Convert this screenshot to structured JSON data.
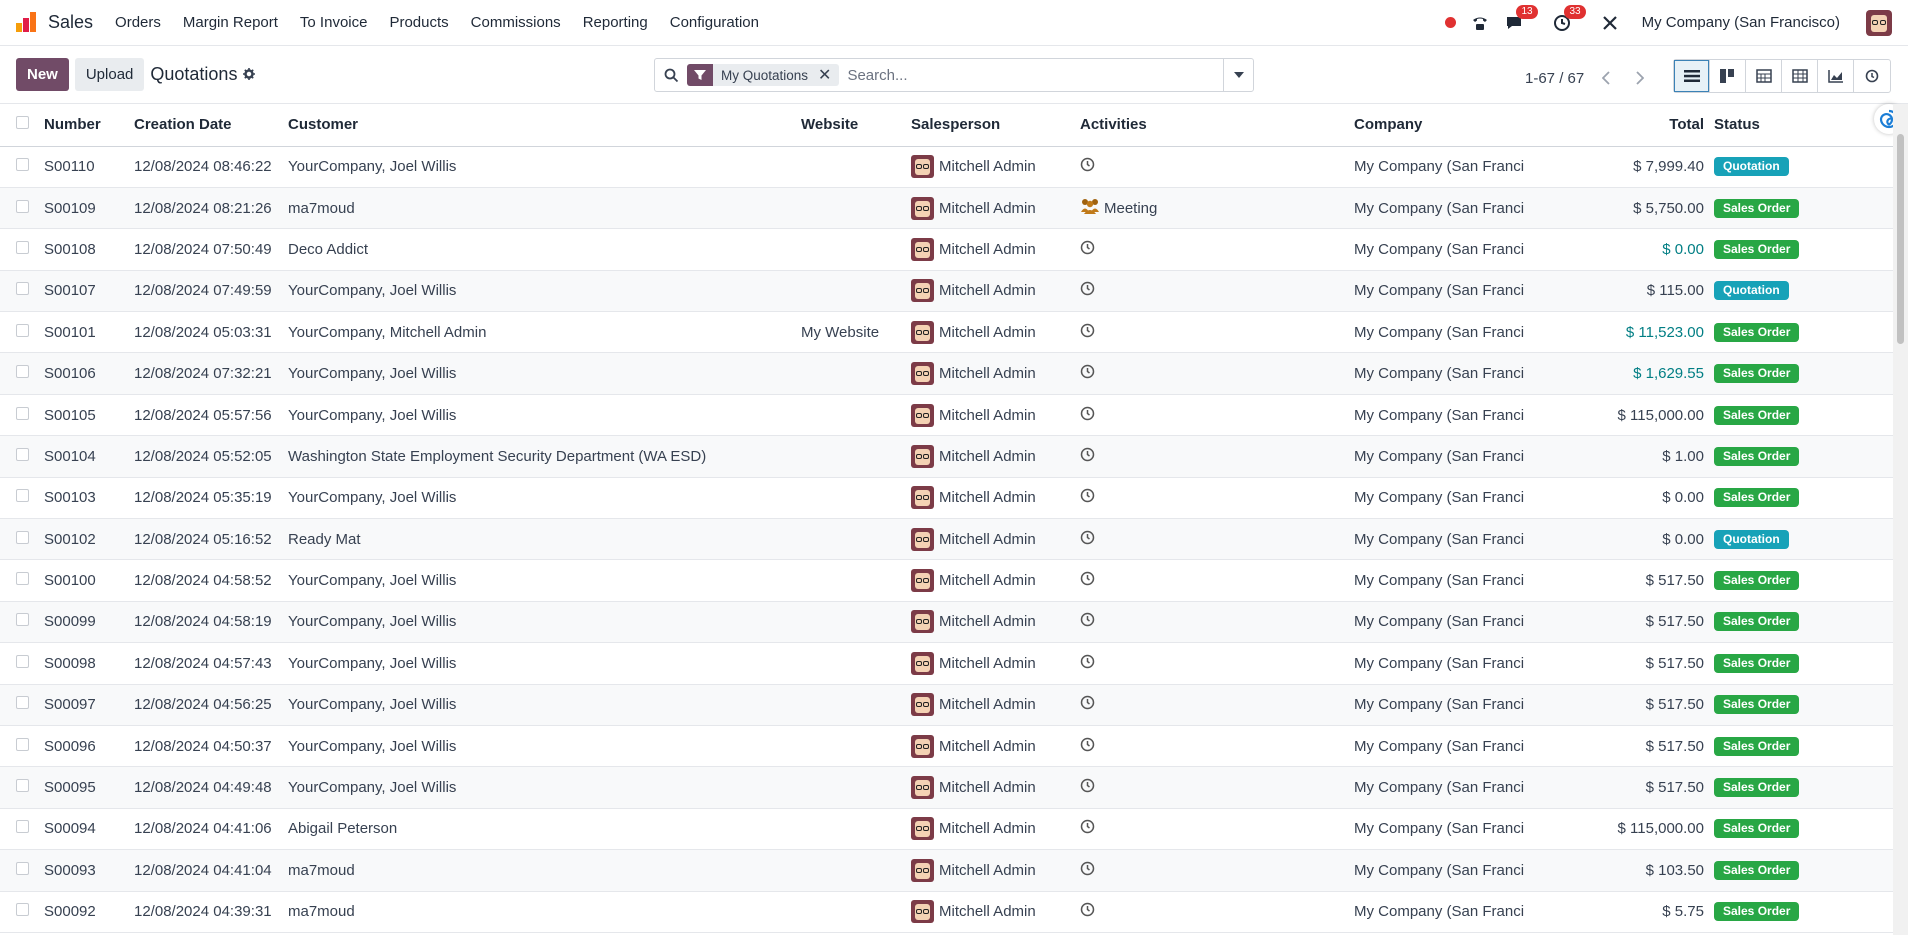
{
  "navbar": {
    "app_name": "Sales",
    "menu": [
      "Orders",
      "Margin Report",
      "To Invoice",
      "Products",
      "Commissions",
      "Reporting",
      "Configuration"
    ],
    "messages_count": "13",
    "activities_count": "33",
    "company": "My Company (San Francisco)"
  },
  "control": {
    "new_label": "New",
    "upload_label": "Upload",
    "breadcrumb": "Quotations",
    "facet_label": "My Quotations",
    "search_placeholder": "Search...",
    "pager": "1-67 / 67"
  },
  "table": {
    "headers": {
      "number": "Number",
      "creation_date": "Creation Date",
      "customer": "Customer",
      "website": "Website",
      "salesperson": "Salesperson",
      "activities": "Activities",
      "company": "Company",
      "total": "Total",
      "status": "Status"
    },
    "rows": [
      {
        "number": "S00110",
        "date": "12/08/2024 08:46:22",
        "customer": "YourCompany, Joel Willis",
        "website": "",
        "salesperson": "Mitchell Admin",
        "activity": "",
        "company": "My Company (San Francisco)",
        "total": "$ 7,999.40",
        "total_highlight": false,
        "status": "Quotation"
      },
      {
        "number": "S00109",
        "date": "12/08/2024 08:21:26",
        "customer": "ma7moud",
        "website": "",
        "salesperson": "Mitchell Admin",
        "activity": "Meeting",
        "company": "My Company (San Francisco)",
        "total": "$ 5,750.00",
        "total_highlight": false,
        "status": "Sales Order"
      },
      {
        "number": "S00108",
        "date": "12/08/2024 07:50:49",
        "customer": "Deco Addict",
        "website": "",
        "salesperson": "Mitchell Admin",
        "activity": "",
        "company": "My Company (San Francisco)",
        "total": "$ 0.00",
        "total_highlight": true,
        "status": "Sales Order"
      },
      {
        "number": "S00107",
        "date": "12/08/2024 07:49:59",
        "customer": "YourCompany, Joel Willis",
        "website": "",
        "salesperson": "Mitchell Admin",
        "activity": "",
        "company": "My Company (San Francisco)",
        "total": "$ 115.00",
        "total_highlight": false,
        "status": "Quotation"
      },
      {
        "number": "S00101",
        "date": "12/08/2024 05:03:31",
        "customer": "YourCompany, Mitchell Admin",
        "website": "My Website",
        "salesperson": "Mitchell Admin",
        "activity": "",
        "company": "My Company (San Francisco)",
        "total": "$ 11,523.00",
        "total_highlight": true,
        "status": "Sales Order"
      },
      {
        "number": "S00106",
        "date": "12/08/2024 07:32:21",
        "customer": "YourCompany, Joel Willis",
        "website": "",
        "salesperson": "Mitchell Admin",
        "activity": "",
        "company": "My Company (San Francisco)",
        "total": "$ 1,629.55",
        "total_highlight": true,
        "status": "Sales Order"
      },
      {
        "number": "S00105",
        "date": "12/08/2024 05:57:56",
        "customer": "YourCompany, Joel Willis",
        "website": "",
        "salesperson": "Mitchell Admin",
        "activity": "",
        "company": "My Company (San Francisco)",
        "total": "$ 115,000.00",
        "total_highlight": false,
        "status": "Sales Order"
      },
      {
        "number": "S00104",
        "date": "12/08/2024 05:52:05",
        "customer": "Washington State Employment Security Department (WA ESD)",
        "website": "",
        "salesperson": "Mitchell Admin",
        "activity": "",
        "company": "My Company (San Francisco)",
        "total": "$ 1.00",
        "total_highlight": false,
        "status": "Sales Order"
      },
      {
        "number": "S00103",
        "date": "12/08/2024 05:35:19",
        "customer": "YourCompany, Joel Willis",
        "website": "",
        "salesperson": "Mitchell Admin",
        "activity": "",
        "company": "My Company (San Francisco)",
        "total": "$ 0.00",
        "total_highlight": false,
        "status": "Sales Order"
      },
      {
        "number": "S00102",
        "date": "12/08/2024 05:16:52",
        "customer": "Ready Mat",
        "website": "",
        "salesperson": "Mitchell Admin",
        "activity": "",
        "company": "My Company (San Francisco)",
        "total": "$ 0.00",
        "total_highlight": false,
        "status": "Quotation"
      },
      {
        "number": "S00100",
        "date": "12/08/2024 04:58:52",
        "customer": "YourCompany, Joel Willis",
        "website": "",
        "salesperson": "Mitchell Admin",
        "activity": "",
        "company": "My Company (San Francisco)",
        "total": "$ 517.50",
        "total_highlight": false,
        "status": "Sales Order"
      },
      {
        "number": "S00099",
        "date": "12/08/2024 04:58:19",
        "customer": "YourCompany, Joel Willis",
        "website": "",
        "salesperson": "Mitchell Admin",
        "activity": "",
        "company": "My Company (San Francisco)",
        "total": "$ 517.50",
        "total_highlight": false,
        "status": "Sales Order"
      },
      {
        "number": "S00098",
        "date": "12/08/2024 04:57:43",
        "customer": "YourCompany, Joel Willis",
        "website": "",
        "salesperson": "Mitchell Admin",
        "activity": "",
        "company": "My Company (San Francisco)",
        "total": "$ 517.50",
        "total_highlight": false,
        "status": "Sales Order"
      },
      {
        "number": "S00097",
        "date": "12/08/2024 04:56:25",
        "customer": "YourCompany, Joel Willis",
        "website": "",
        "salesperson": "Mitchell Admin",
        "activity": "",
        "company": "My Company (San Francisco)",
        "total": "$ 517.50",
        "total_highlight": false,
        "status": "Sales Order"
      },
      {
        "number": "S00096",
        "date": "12/08/2024 04:50:37",
        "customer": "YourCompany, Joel Willis",
        "website": "",
        "salesperson": "Mitchell Admin",
        "activity": "",
        "company": "My Company (San Francisco)",
        "total": "$ 517.50",
        "total_highlight": false,
        "status": "Sales Order"
      },
      {
        "number": "S00095",
        "date": "12/08/2024 04:49:48",
        "customer": "YourCompany, Joel Willis",
        "website": "",
        "salesperson": "Mitchell Admin",
        "activity": "",
        "company": "My Company (San Francisco)",
        "total": "$ 517.50",
        "total_highlight": false,
        "status": "Sales Order"
      },
      {
        "number": "S00094",
        "date": "12/08/2024 04:41:06",
        "customer": "Abigail Peterson",
        "website": "",
        "salesperson": "Mitchell Admin",
        "activity": "",
        "company": "My Company (San Francisco)",
        "total": "$ 115,000.00",
        "total_highlight": false,
        "status": "Sales Order"
      },
      {
        "number": "S00093",
        "date": "12/08/2024 04:41:04",
        "customer": "ma7moud",
        "website": "",
        "salesperson": "Mitchell Admin",
        "activity": "",
        "company": "My Company (San Francisco)",
        "total": "$ 103.50",
        "total_highlight": false,
        "status": "Sales Order"
      },
      {
        "number": "S00092",
        "date": "12/08/2024 04:39:31",
        "customer": "ma7moud",
        "website": "",
        "salesperson": "Mitchell Admin",
        "activity": "",
        "company": "My Company (San Francisco)",
        "total": "$ 5.75",
        "total_highlight": false,
        "status": "Sales Order"
      }
    ]
  },
  "colors": {
    "brand": "#714b67",
    "quotation_badge": "#17a2b8",
    "sales_order_badge": "#28a745",
    "highlight_amount": "#017e84"
  }
}
